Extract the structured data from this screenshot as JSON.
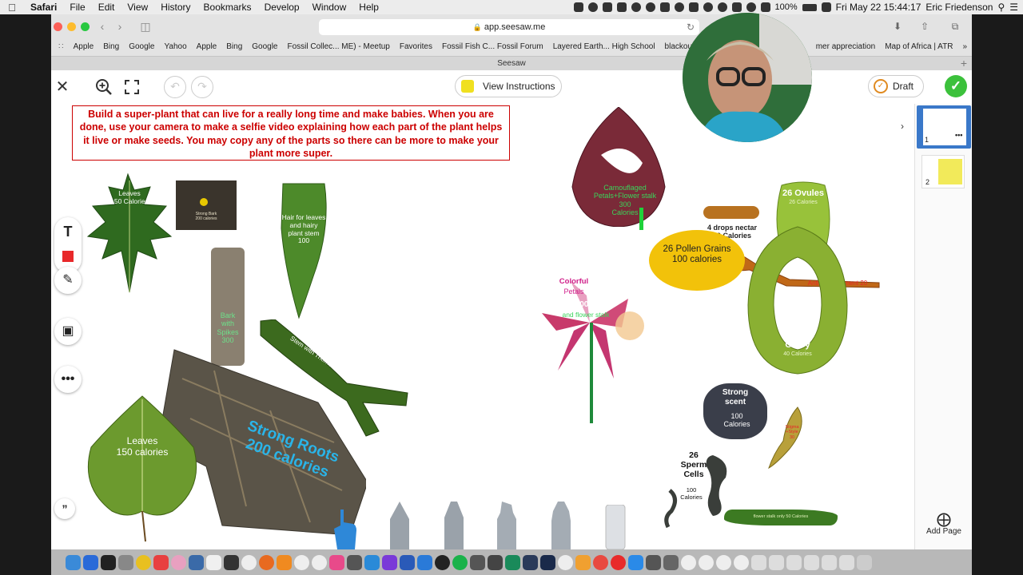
{
  "menubar": {
    "items": [
      "Safari",
      "File",
      "Edit",
      "View",
      "History",
      "Bookmarks",
      "Develop",
      "Window",
      "Help"
    ],
    "battery": "100%",
    "datetime": "Fri May 22  15:44:17",
    "user": "Eric Friedenson"
  },
  "browser": {
    "address": "app.seesaw.me",
    "bookmarks": [
      "Apple",
      "Bing",
      "Google",
      "Yahoo",
      "Apple",
      "Bing",
      "Google",
      "Fossil Collec... ME) - Meetup",
      "Favorites",
      "Fossil Fish C... Fossil Forum",
      "Layered Earth... High School",
      "blackout drap...o",
      "",
      "mer appreciation",
      "Map of Africa | ATR"
    ],
    "tab_title": "Seesaw"
  },
  "toolbar": {
    "view_instructions": "View Instructions",
    "draft": "Draft"
  },
  "instruction_text": "Build a super-plant that can live for a really long time and make babies.  When you are done, use your camera to make a selfie video explaining how each part of the plant helps it live or make seeds.  You may copy any of the parts so there can be more to make your plant more super.",
  "labels": {
    "oak_leaves": "Leaves\n150 Calories",
    "bark": "Strong Bark\n200 calories",
    "hair_leaves": "Hair for leaves\nand hairy\nplant stem\n100",
    "bark_spikes": "Bark\nwith\nSpikes\n300",
    "thorn_stem": "Stem with Thorns 200",
    "roots": "Strong Roots\n200 calories",
    "heart_leaf": "Leaves\n150 calories",
    "camouflage": "Camouflaged\nPetals+Flower stalk\n300\nCalories",
    "nectar": "4 drops nectar\n50 Calories",
    "ovules_title": "26 Ovules",
    "ovules_sub": "26 Calories",
    "anther": "Anther + Filament 20",
    "pollen": "26 Pollen Grains\n100 calories",
    "colorful_title": "Colorful",
    "colorful_sub": "Petals",
    "colorful_num": "200",
    "flower_stalk": "and flower stalk",
    "ovary_title": "Ovary",
    "ovary_sub": "40 Calories",
    "scent": "Strong\nscent",
    "scent_cal": "100\nCalories",
    "stigma": "Stigma\n+Style\n30",
    "sperm_title": "26\nSperm\nCells",
    "sperm_sub": "100\nCalories",
    "stalk_only": "flower stalk only 50 Calories"
  },
  "pages": {
    "page1": "1",
    "page2": "2",
    "add_page": "Add Page"
  }
}
